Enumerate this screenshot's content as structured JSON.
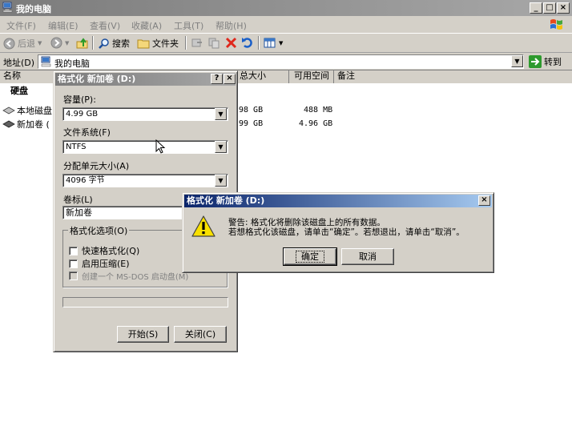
{
  "window": {
    "title": "我的电脑",
    "cap_min": "_",
    "cap_max": "□",
    "cap_close": "×"
  },
  "menu": {
    "items": [
      "文件(F)",
      "编辑(E)",
      "查看(V)",
      "收藏(A)",
      "工具(T)",
      "帮助(H)"
    ]
  },
  "toolbar": {
    "back_label": "后退",
    "search_label": "搜索",
    "folders_label": "文件夹"
  },
  "address": {
    "label": "地址(D)",
    "value": "我的电脑",
    "go_label": "转到"
  },
  "list": {
    "col_name": "名称",
    "col_total": "总大小",
    "col_free": "可用空间",
    "col_note": "备注",
    "group_hdd": "硬盘",
    "rows": [
      {
        "name": "本地磁盘",
        "total": "98 GB",
        "free": "488 MB"
      },
      {
        "name": "新加卷 (",
        "total": "99 GB",
        "free": "4.96 GB"
      }
    ]
  },
  "format_dialog": {
    "title": "格式化 新加卷 (D:)",
    "help": "?",
    "close": "×",
    "capacity_label": "容量(P):",
    "capacity_value": "4.99 GB",
    "fs_label": "文件系统(F)",
    "fs_value": "NTFS",
    "alloc_label": "分配单元大小(A)",
    "alloc_value": "4096 字节",
    "volume_label": "卷标(L)",
    "volume_value": "新加卷",
    "options_label": "格式化选项(O)",
    "opt_quick": "快速格式化(Q)",
    "opt_compress": "启用压缩(E)",
    "opt_msdos": "创建一个 MS-DOS 启动盘(M)",
    "start_label": "开始(S)",
    "close_label": "关闭(C)"
  },
  "warning_dialog": {
    "title": "格式化 新加卷 (D:)",
    "close": "×",
    "line1": "警告: 格式化将删除该磁盘上的所有数据。",
    "line2": "若想格式化该磁盘，请单击“确定”。若想退出，请单击“取消”。",
    "ok_label": "确定",
    "cancel_label": "取消"
  }
}
